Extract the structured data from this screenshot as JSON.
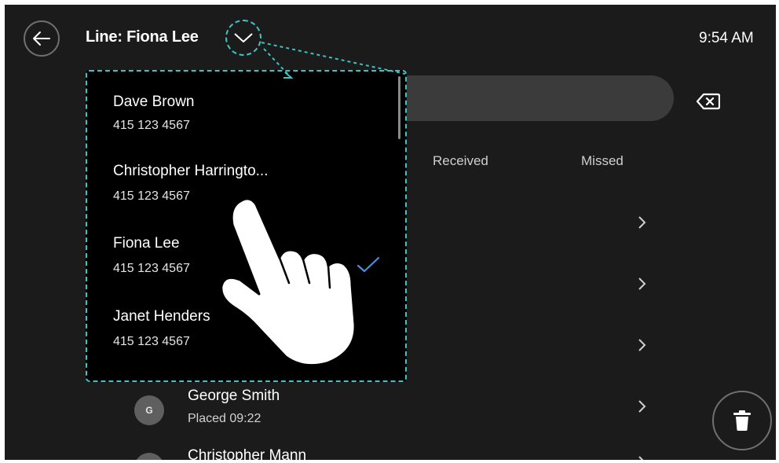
{
  "header": {
    "title": "Line: Fiona Lee",
    "time": "9:54 AM"
  },
  "tabs": [
    {
      "label": "Received"
    },
    {
      "label": "Missed"
    }
  ],
  "line_selector": {
    "items": [
      {
        "name": "Dave Brown",
        "number": "415 123 4567",
        "selected": false
      },
      {
        "name": "Christopher Harringto...",
        "number": "415 123 4567",
        "selected": false
      },
      {
        "name": "Fiona Lee",
        "number": "415 123 4567",
        "selected": true
      },
      {
        "name": "Janet Henders",
        "number": "415 123 4567",
        "selected": false
      }
    ]
  },
  "recents": [
    {
      "initial": "G",
      "name": "George Smith",
      "detail": "Placed 09:22"
    },
    {
      "initial": "",
      "name": "Christopher Mann",
      "detail": ""
    }
  ],
  "icons": {
    "back": "arrow-left-icon",
    "dropdown": "chevron-down-icon",
    "clear": "backspace-icon",
    "row": "chevron-right-icon",
    "selected": "checkmark-icon",
    "delete": "trash-icon",
    "pointer": "hand-pointer-icon"
  },
  "colors": {
    "background": "#1b1b1b",
    "dropdown_bg": "#000000",
    "highlight_outline": "#3cc3c3",
    "checkmark": "#4a90d9"
  }
}
